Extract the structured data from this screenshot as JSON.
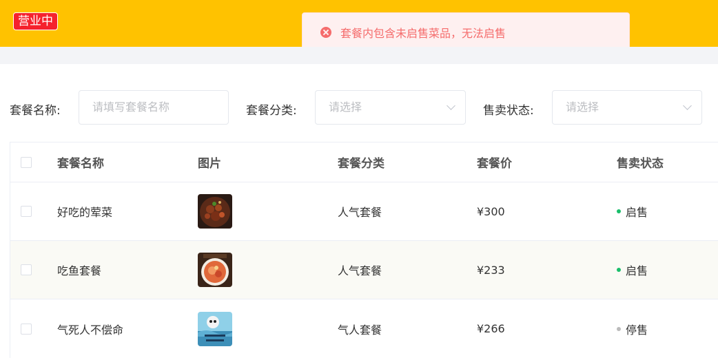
{
  "header": {
    "status_tag": "营业中"
  },
  "toast": {
    "message": "套餐内包含未启售菜品，无法启售",
    "color": "#f56c6c"
  },
  "filters": {
    "name": {
      "label": "套餐名称:",
      "placeholder": "请填写套餐名称"
    },
    "category": {
      "label": "套餐分类:",
      "placeholder": "请选择"
    },
    "status": {
      "label": "售卖状态:",
      "placeholder": "请选择"
    }
  },
  "table": {
    "columns": [
      "套餐名称",
      "图片",
      "套餐分类",
      "套餐价",
      "售卖状态"
    ],
    "rows": [
      {
        "name": "好吃的荤菜",
        "image": "food-photo-meat",
        "category": "人气套餐",
        "price": "¥300",
        "status": "启售",
        "status_color": "#19be6b"
      },
      {
        "name": "吃鱼套餐",
        "image": "food-photo-fish",
        "category": "人气套餐",
        "price": "¥233",
        "status": "启售",
        "status_color": "#19be6b"
      },
      {
        "name": "气死人不偿命",
        "image": "food-photo-meme",
        "category": "气人套餐",
        "price": "¥266",
        "status": "停售",
        "status_color": "#bbbbbb"
      }
    ]
  },
  "colors": {
    "brand": "#ffc200",
    "tag_red": "#f5222d"
  }
}
